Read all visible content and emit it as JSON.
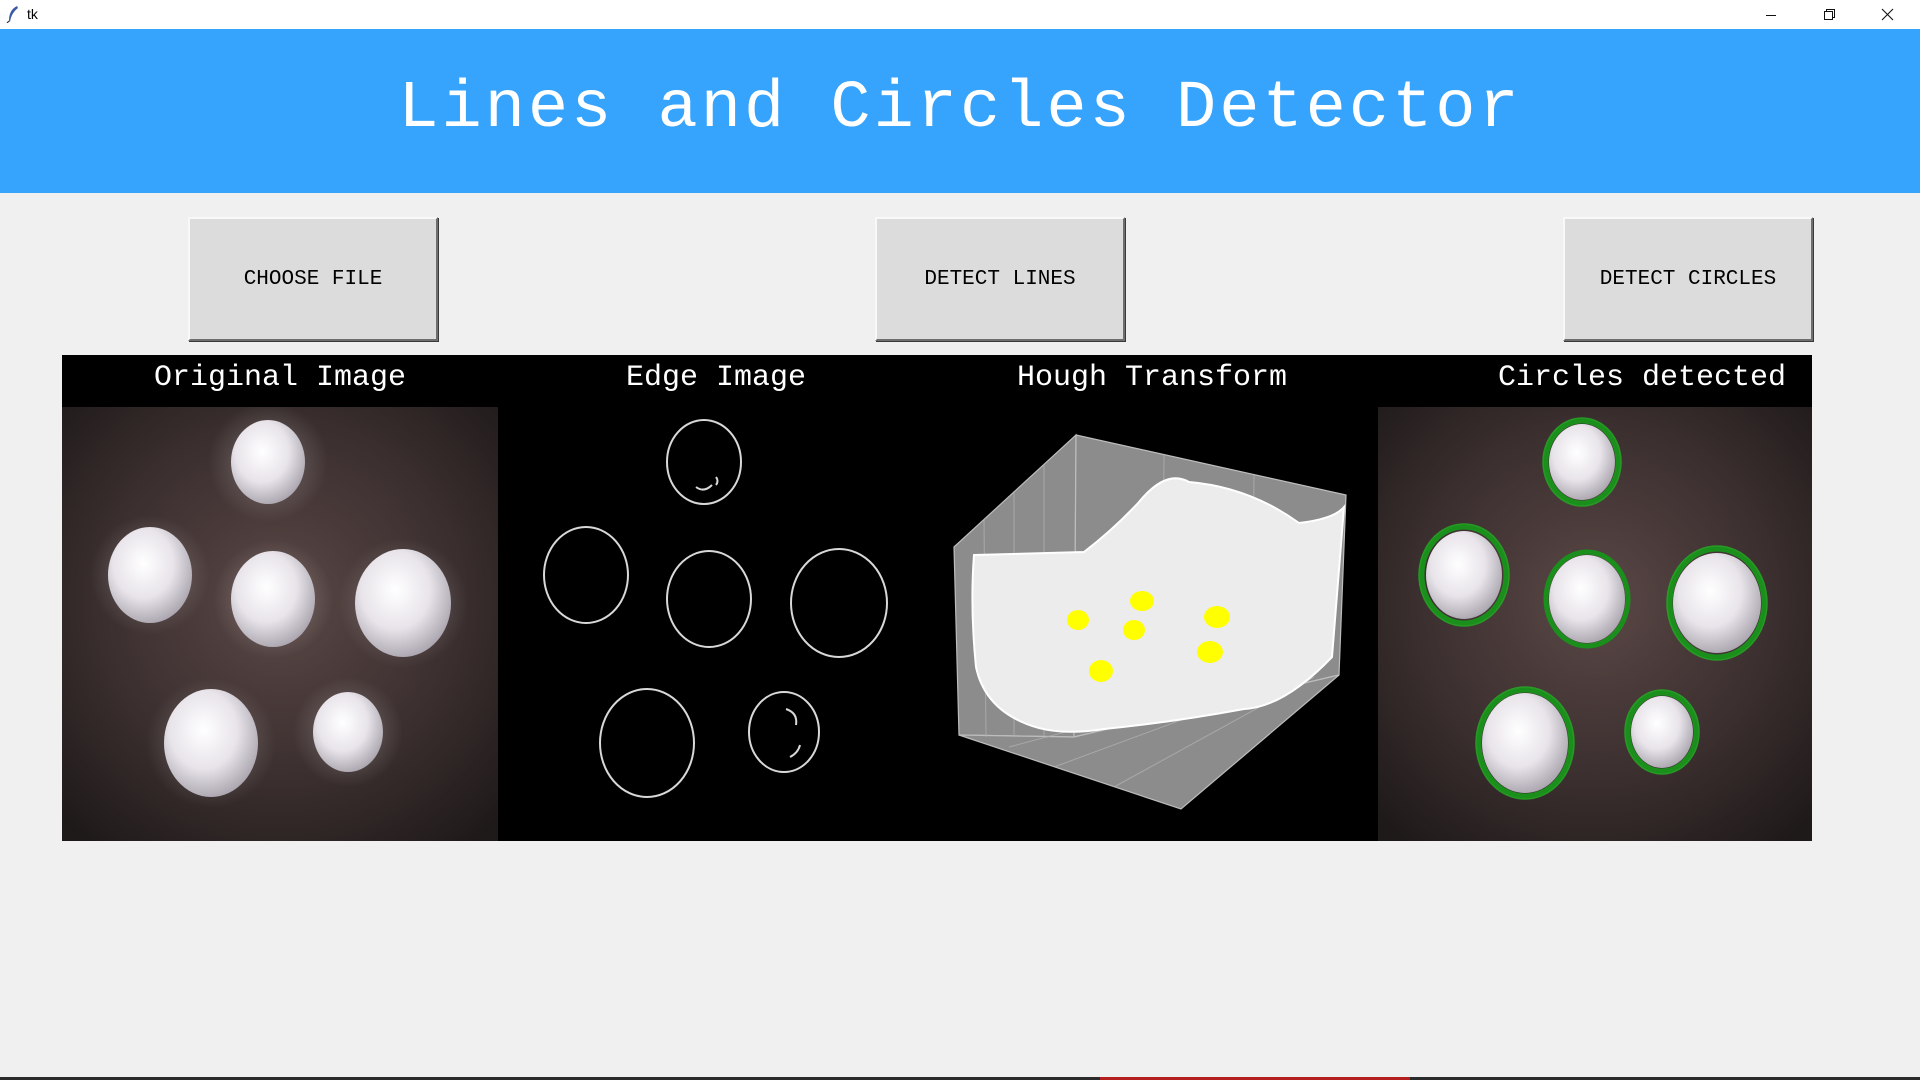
{
  "window": {
    "title": "tk",
    "icons": [
      "tk-feather-icon",
      "minimize-icon",
      "maximize-icon",
      "close-icon"
    ]
  },
  "header": {
    "title": "Lines and Circles Detector",
    "background": "#36a3fd"
  },
  "buttons": {
    "choose_file": "CHOOSE FILE",
    "detect_lines": "DETECT LINES",
    "detect_circles": "DETECT CIRCLES"
  },
  "panels": {
    "original": "Original Image",
    "edge": "Edge Image",
    "hough": "Hough Transform",
    "circles": "Circles detected"
  },
  "colors": {
    "detected_circle": "#1b8f1b",
    "hough_peak": "#ffff00"
  }
}
